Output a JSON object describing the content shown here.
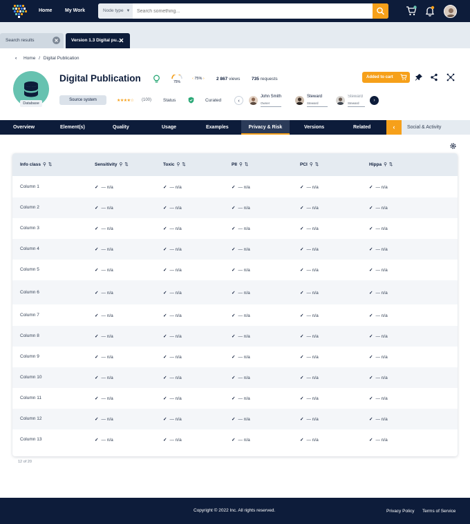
{
  "topbar": {
    "nav": [
      "Home",
      "My Work"
    ],
    "node_type": "Node type",
    "search_placeholder": "Search something..."
  },
  "page_tabs": [
    {
      "label": "Search results"
    },
    {
      "label": "Version 1.3 Digital pu..."
    }
  ],
  "breadcrumb": {
    "home": "Home",
    "sep": "/",
    "current": "Digital Publication"
  },
  "asset": {
    "title": "Digital Publication",
    "badge": "Database",
    "gauge_1": "75%",
    "gauge_2": "75%",
    "views_num": "2 867",
    "views_label": "views",
    "requests_num": "735",
    "requests_label": "requests",
    "cart_label": "Added to cart",
    "source_label": "Source system",
    "stars": "★★★★☆",
    "rating_count": "(100)",
    "status_label": "Status",
    "curated_label": "Curated",
    "people": [
      {
        "name": "John Smith",
        "role": "Owner"
      },
      {
        "name": "Steward",
        "role": "Steward"
      },
      {
        "name": "Steward",
        "role": "Steward"
      }
    ]
  },
  "main_tabs": [
    "Overview",
    "Element(s)",
    "Quality",
    "Usage",
    "Examples",
    "Privacy & Risk",
    "Versions",
    "Related",
    "Social & Activity"
  ],
  "active_tab": "Privacy & Risk",
  "table": {
    "columns": [
      "Info class",
      "Sensitivity",
      "Toxic",
      "PII",
      "PCI",
      "Hippa"
    ],
    "rows": [
      {
        "label": "Column 1",
        "values": [
          "— n/a",
          "— n/a",
          "— n/a",
          "— n/a",
          "— n/a"
        ]
      },
      {
        "label": "Column 2",
        "values": [
          "— n/a",
          "— n/a",
          "— n/a",
          "— n/a",
          "— n/a"
        ]
      },
      {
        "label": "Column 3",
        "values": [
          "— n/a",
          "— n/a",
          "— n/a",
          "— n/a",
          "— n/a"
        ]
      },
      {
        "label": "Column 4",
        "values": [
          "— n/a",
          "— n/a",
          "— n/a",
          "— n/a",
          "— n/a"
        ]
      },
      {
        "label": "Column 5",
        "values": [
          "— n/a",
          "— n/a",
          "— n/a",
          "— n/a",
          "— n/a"
        ]
      },
      {
        "label": "Column 6",
        "values": [
          "— n/a",
          "— n/a",
          "— n/a",
          "— n/a",
          "— n/a"
        ]
      },
      {
        "label": "Column 7",
        "values": [
          "— n/a",
          "— n/a",
          "— n/a",
          "— n/a",
          "— n/a"
        ]
      },
      {
        "label": "Column 8",
        "values": [
          "— n/a",
          "— n/a",
          "— n/a",
          "— n/a",
          "— n/a"
        ]
      },
      {
        "label": "Column 9",
        "values": [
          "— n/a",
          "— n/a",
          "— n/a",
          "— n/a",
          "— n/a"
        ]
      },
      {
        "label": "Column 10",
        "values": [
          "— n/a",
          "— n/a",
          "— n/a",
          "— n/a",
          "— n/a"
        ]
      },
      {
        "label": "Column 11",
        "values": [
          "— n/a",
          "— n/a",
          "— n/a",
          "— n/a",
          "— n/a"
        ]
      },
      {
        "label": "Column 12",
        "values": [
          "— n/a",
          "— n/a",
          "— n/a",
          "— n/a",
          "— n/a"
        ]
      },
      {
        "label": "Column 13",
        "values": [
          "— n/a",
          "— n/a",
          "— n/a",
          "— n/a",
          "— n/a"
        ]
      }
    ],
    "pager": "12 of 20"
  },
  "footer": {
    "copyright": "Copyright © 2022 Inc. All rights reserved.",
    "privacy": "Privacy Policy",
    "terms": "Terms of Service"
  },
  "colors": {
    "navy": "#0d1c3a",
    "accent": "#f6a01a",
    "teal": "#66c2b0",
    "check_green": "#2aa876"
  },
  "icons": [
    "app-logo-icon",
    "search-icon",
    "cart-icon",
    "bell-icon",
    "check-icon",
    "settings-icon",
    "pin-icon",
    "share-icon",
    "network-icon",
    "database-icon",
    "lightbulb-icon",
    "shield-icon"
  ]
}
